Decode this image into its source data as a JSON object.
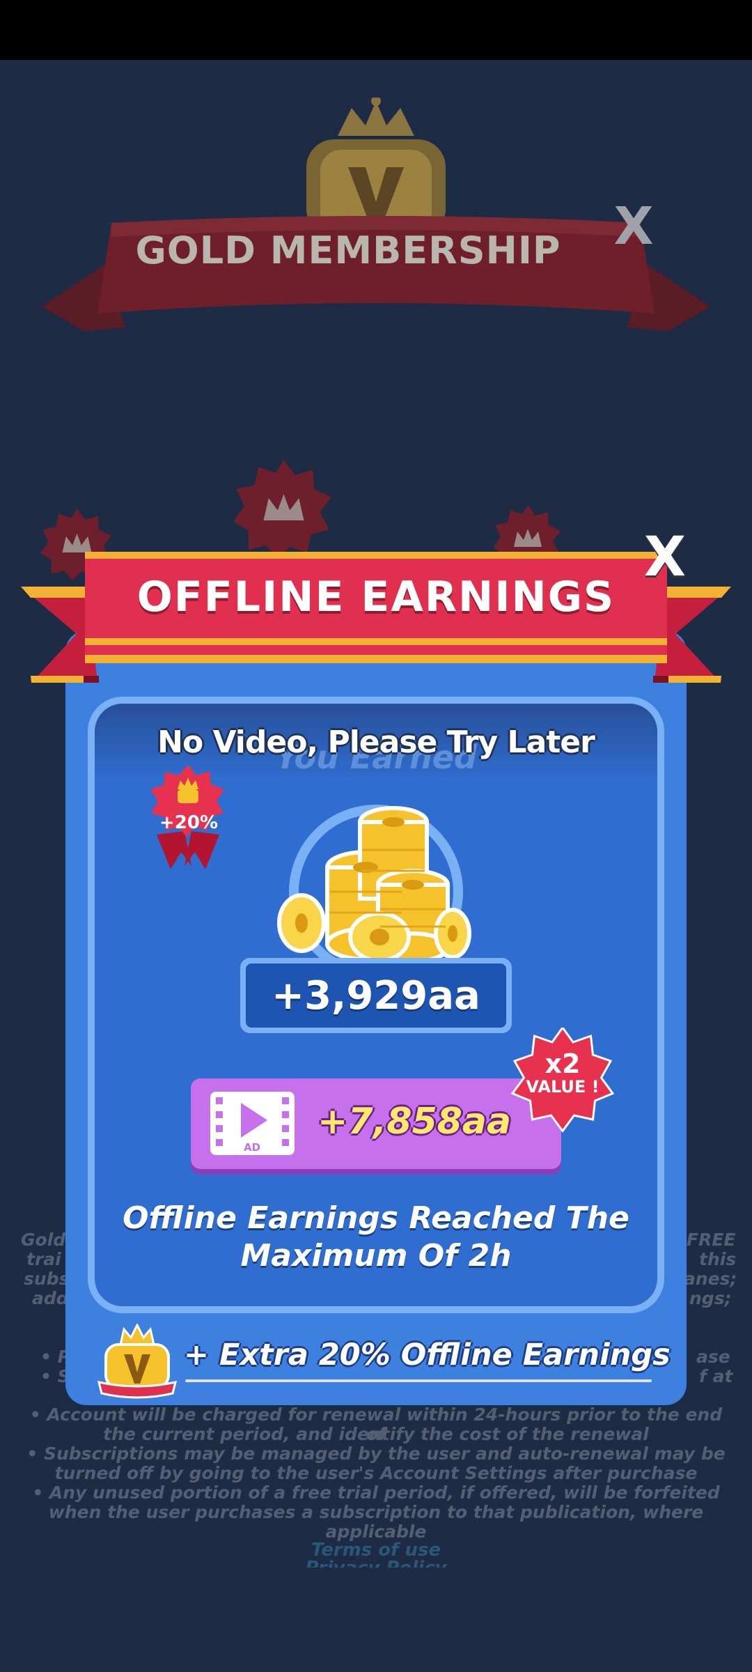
{
  "background_dialog": {
    "title": "GOLD MEMBERSHIP",
    "close_label": "X",
    "left_fragments": [
      "Gold",
      "trai",
      "subs",
      "add",
      "• P",
      "• S"
    ],
    "right_fragments": [
      "FREE",
      "this",
      "anes;",
      "ngs;",
      "ase",
      "f at"
    ],
    "terms_lines": [
      "• Account will be charged for renewal within 24-hours prior to the end of",
      "the current period, and identify the cost of the renewal",
      "• Subscriptions may be managed by the user and auto-renewal may be",
      "turned off by going to the user's Account Settings after purchase",
      "• Any unused portion of a free trial period, if offered, will be forfeited",
      "when the user purchases a subscription to that publication, where",
      "applicable"
    ],
    "terms_link": "Terms of use",
    "privacy_link_fragment": "Privacy Policy"
  },
  "popup": {
    "title": "OFFLINE EARNINGS",
    "close_label": "X",
    "subtitle_behind": "You Earned",
    "toast": "No Video, Please Try Later",
    "bonus_badge": "+20%",
    "earned_amount": "+3,929aa",
    "ad_button": {
      "icon_label": "AD",
      "amount": "+7,858aa"
    },
    "multiplier_badge": {
      "big": "x2",
      "small": "VALUE !"
    },
    "message_line1": "Offline Earnings Reached The",
    "message_line2": "Maximum Of 2h",
    "extra_bonus": "+ Extra 20%  Offline Earnings"
  },
  "colors": {
    "panel": "#3d80df",
    "banner_red": "#e02f4f",
    "ad_button": "#c670ec",
    "gold": "#f6c22b"
  }
}
